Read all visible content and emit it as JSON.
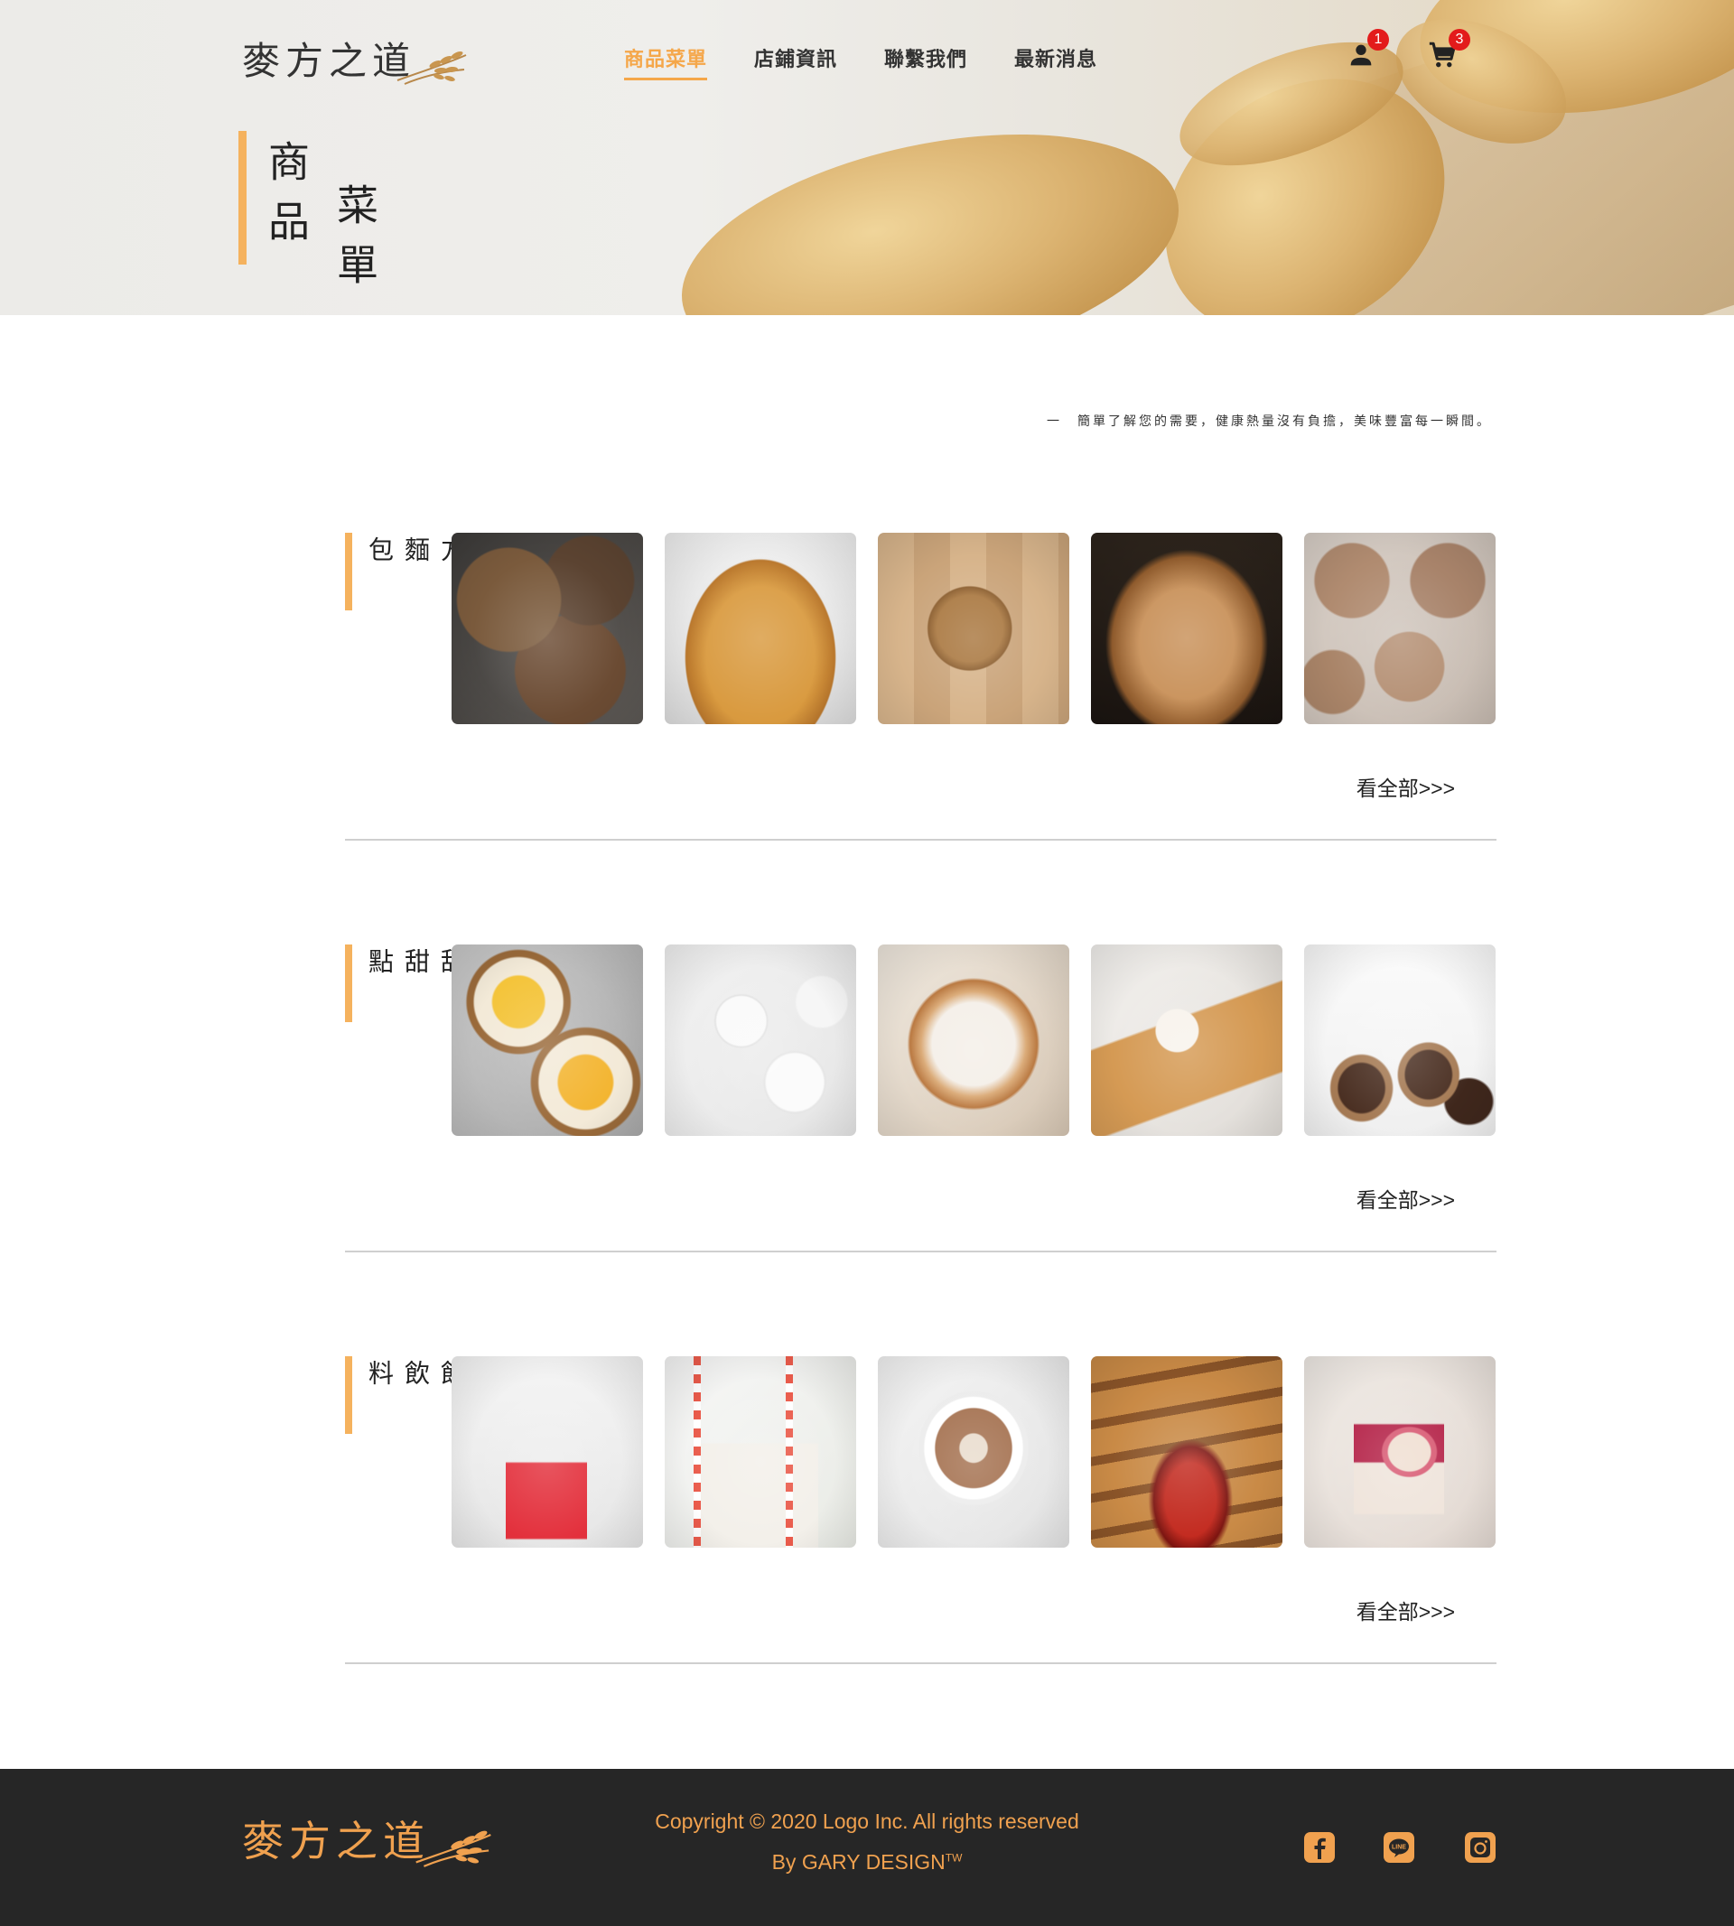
{
  "brand": {
    "logo_text": "麥方之道"
  },
  "nav": {
    "items": [
      {
        "label": "商品菜單",
        "active": true
      },
      {
        "label": "店鋪資訊",
        "active": false
      },
      {
        "label": "聯繫我們",
        "active": false
      },
      {
        "label": "最新消息",
        "active": false
      }
    ]
  },
  "header_icons": {
    "user": {
      "icon": "user-icon",
      "badge": "1"
    },
    "cart": {
      "icon": "cart-icon",
      "badge": "3"
    }
  },
  "page_title": {
    "col1": "商品",
    "col2": "菜單"
  },
  "tagline": "一　簡單了解您的需要，健康熱量沒有負擔，美味豐富每一瞬間。",
  "sections": [
    {
      "title": "麥方麵包",
      "see_all": "看全部>>>"
    },
    {
      "title": "甜甜點",
      "see_all": "看全部>>>"
    },
    {
      "title": "飲飲料",
      "see_all": "看全部>>>"
    }
  ],
  "footer": {
    "logo_text": "麥方之道",
    "copyright": "Copyright © 2020 Logo Inc. All rights reserved",
    "credit": "By GARY DESIGN",
    "credit_mark": "TW",
    "social": [
      "facebook-icon",
      "line-icon",
      "instagram-icon"
    ]
  },
  "colors": {
    "accent": "#f5a74a",
    "footer_bg": "#262626",
    "footer_text": "#f0a14f",
    "badge": "#e31b1b"
  }
}
